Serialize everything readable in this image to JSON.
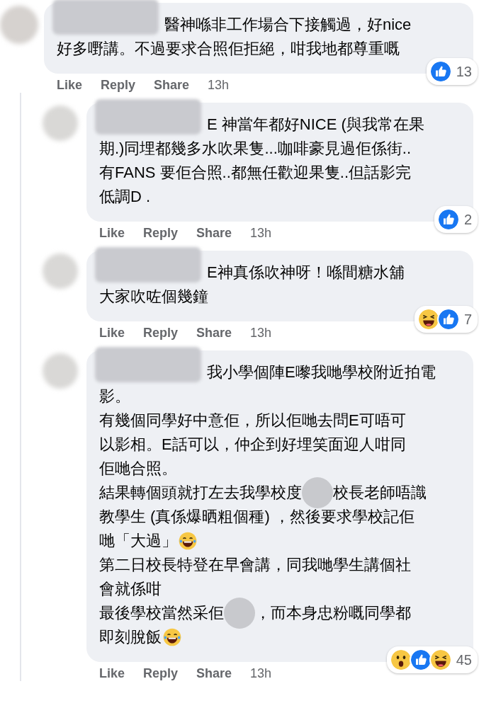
{
  "comment": {
    "lines": [
      [
        {
          "kind": "redaction"
        },
        {
          "kind": "text",
          "text": "醫神喺非工作場合下接觸過，好nice"
        }
      ],
      [
        {
          "kind": "text",
          "text": "好多嘢講。不過要求合照佢拒絕，咁我地都尊重嘅"
        }
      ]
    ],
    "actions": [
      "Like",
      "Reply",
      "Share"
    ],
    "time": "13h",
    "reactions": [
      {
        "kind": "like"
      }
    ],
    "reaction_count": "13"
  },
  "replies": [
    {
      "lines": [
        [
          {
            "kind": "redaction"
          },
          {
            "kind": "text",
            "text": "E 神當年都好NICE (與我常在果"
          }
        ],
        [
          {
            "kind": "text",
            "text": "期.)同埋都幾多水吹果隻...咖啡豪見過佢係街.."
          }
        ],
        [
          {
            "kind": "text",
            "text": "有FANS 要佢合照..都無任歡迎果隻..但話影完"
          }
        ],
        [
          {
            "kind": "text",
            "text": "低調D ."
          }
        ]
      ],
      "actions": [
        "Like",
        "Reply",
        "Share"
      ],
      "time": "13h",
      "reactions": [
        {
          "kind": "like"
        }
      ],
      "reaction_count": "2"
    },
    {
      "lines": [
        [
          {
            "kind": "redaction"
          },
          {
            "kind": "text",
            "text": "E神真係吹神呀！喺間糖水舖"
          }
        ],
        [
          {
            "kind": "text",
            "text": "大家吹咗個幾鐘"
          }
        ]
      ],
      "actions": [
        "Like",
        "Reply",
        "Share"
      ],
      "time": "13h",
      "reactions": [
        {
          "kind": "haha"
        },
        {
          "kind": "like"
        }
      ],
      "reaction_count": "7"
    },
    {
      "lines": [
        [
          {
            "kind": "redaction"
          },
          {
            "kind": "text",
            "text": "我小學個陣E嚟我哋學校附近拍電"
          }
        ],
        [
          {
            "kind": "text",
            "text": "影。"
          }
        ],
        [
          {
            "kind": "text",
            "text": "有幾個同學好中意佢，所以佢哋去問E可唔可"
          }
        ],
        [
          {
            "kind": "text",
            "text": "以影相。E話可以，仲企到好埋笑面迎人咁同"
          }
        ],
        [
          {
            "kind": "text",
            "text": "佢哋合照。"
          }
        ],
        [
          {
            "kind": "text",
            "text": "結果轉個頭就打左去我學校度"
          },
          {
            "kind": "blur"
          },
          {
            "kind": "text",
            "text": "校長老師唔識"
          }
        ],
        [
          {
            "kind": "text",
            "text": "教學生 (真係爆晒粗個種) ，然後要求學校記佢"
          }
        ],
        [
          {
            "kind": "text",
            "text": "哋「大過」"
          },
          {
            "kind": "emoji"
          }
        ],
        [
          {
            "kind": "text",
            "text": "第二日校長特登在早會講，同我哋學生講個社"
          }
        ],
        [
          {
            "kind": "text",
            "text": "會就係咁"
          }
        ],
        [
          {
            "kind": "text",
            "text": "最後學校當然采佢"
          },
          {
            "kind": "blur"
          },
          {
            "kind": "text",
            "text": "，而本身忠粉嘅同學都"
          }
        ],
        [
          {
            "kind": "text",
            "text": "即刻脫飯"
          },
          {
            "kind": "emoji"
          }
        ]
      ],
      "actions": [
        "Like",
        "Reply",
        "Share"
      ],
      "time": "13h",
      "reactions": [
        {
          "kind": "wow"
        },
        {
          "kind": "like"
        },
        {
          "kind": "haha"
        }
      ],
      "reaction_count": "45"
    }
  ]
}
